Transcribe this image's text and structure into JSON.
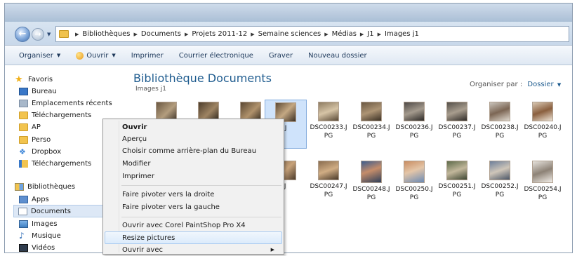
{
  "address": {
    "crumbs": [
      "Bibliothèques",
      "Documents",
      "Projets 2011-12",
      "Semaine sciences",
      "Médias",
      "J1",
      "Images j1"
    ]
  },
  "toolbar": {
    "organiser": "Organiser",
    "ouvrir": "Ouvrir",
    "imprimer": "Imprimer",
    "courrier": "Courrier électronique",
    "graver": "Graver",
    "nouveau_dossier": "Nouveau dossier"
  },
  "nav": {
    "favoris": "Favoris",
    "bureau": "Bureau",
    "emplacements": "Emplacements récents",
    "telechargements": "Téléchargements",
    "ap": "AP",
    "perso": "Perso",
    "dropbox": "Dropbox",
    "telechargements2": "Téléchargements",
    "bibliotheques": "Bibliothèques",
    "apps": "Apps",
    "documents": "Documents",
    "images": "Images",
    "musique": "Musique",
    "videos": "Vidéos"
  },
  "content": {
    "title": "Bibliothèque Documents",
    "subtitle": "Images j1",
    "organize_by_label": "Organiser par :",
    "organize_by_value": "Dossier"
  },
  "thumbs_row1": [
    {
      "label": "0232.J\nG"
    },
    {
      "label": "DSC00233.J\nPG"
    },
    {
      "label": "DSC00234.J\nPG"
    },
    {
      "label": "DSC00236.J\nPG"
    },
    {
      "label": "DSC00237.J\nPG"
    },
    {
      "label": "DSC00238.J\nPG"
    },
    {
      "label": "DSC00240.J\nPG"
    }
  ],
  "thumbs_row2": [
    {
      "label": "0245.J\nG"
    },
    {
      "label": "DSC00247.J\nPG"
    },
    {
      "label": "DSC00248.J\nPG"
    },
    {
      "label": "DSC00250.J\nPG"
    },
    {
      "label": "DSC00251.J\nPG"
    },
    {
      "label": "DSC00252.J\nPG"
    },
    {
      "label": "DSC00254.J\nPG"
    }
  ],
  "context_menu": {
    "ouvrir": "Ouvrir",
    "apercu": "Aperçu",
    "arriere_plan": "Choisir comme arrière-plan du Bureau",
    "modifier": "Modifier",
    "imprimer": "Imprimer",
    "pivoter_droite": "Faire pivoter vers la droite",
    "pivoter_gauche": "Faire pivoter vers la gauche",
    "ouvrir_corel": "Ouvrir avec Corel PaintShop Pro X4",
    "resize": "Resize pictures",
    "ouvrir_avec": "Ouvrir avec"
  }
}
